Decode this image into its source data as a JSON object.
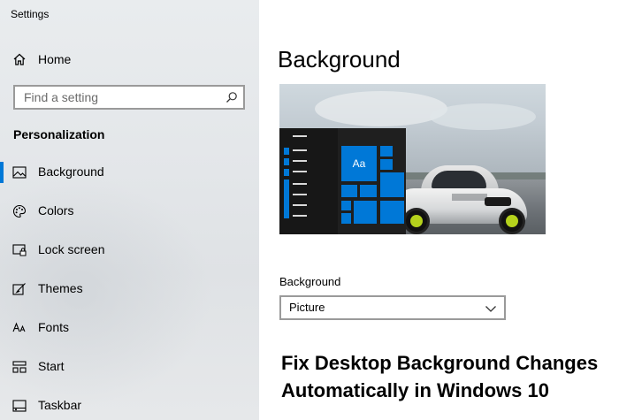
{
  "window": {
    "title": "Settings"
  },
  "sidebar": {
    "home_label": "Home",
    "search": {
      "placeholder": "Find a setting"
    },
    "section_title": "Personalization",
    "items": [
      {
        "label": "Background",
        "icon": "picture-icon",
        "active": true
      },
      {
        "label": "Colors",
        "icon": "palette-icon",
        "active": false
      },
      {
        "label": "Lock screen",
        "icon": "lock-screen-icon",
        "active": false
      },
      {
        "label": "Themes",
        "icon": "themes-brush-icon",
        "active": false
      },
      {
        "label": "Fonts",
        "icon": "fonts-icon",
        "active": false
      },
      {
        "label": "Start",
        "icon": "start-grid-icon",
        "active": false
      },
      {
        "label": "Taskbar",
        "icon": "taskbar-icon",
        "active": false
      }
    ]
  },
  "main": {
    "title": "Background",
    "preview": {
      "tile_text": "Aa"
    },
    "background_label": "Background",
    "background_select": {
      "value": "Picture",
      "icon": "chevron-down-icon"
    }
  },
  "caption": {
    "line1": "Fix Desktop Background Changes",
    "line2": "Automatically in Windows 10"
  },
  "colors": {
    "accent": "#0078d7",
    "sidebar_bg": "#e4e7ea",
    "tile_green": "#b5d21c"
  }
}
